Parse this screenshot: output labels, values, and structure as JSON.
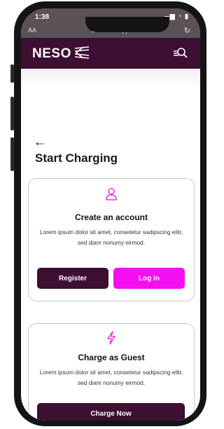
{
  "status_bar": {
    "time": "1:38",
    "icons": "▂▄▆ ◔ ▮"
  },
  "browser": {
    "text_size": "AA",
    "url": "nesoev.app",
    "reload": "↻"
  },
  "header": {
    "logo_text": "NESO",
    "search_icon": "search-icon"
  },
  "page": {
    "back": "←",
    "title": "Start Charging"
  },
  "account_card": {
    "title": "Create an account",
    "text": "Lorem ipsum dolor sit amet, consetetur sadipscing elitr, sed diam nonumy eirmod.",
    "register_label": "Register",
    "login_label": "Log in",
    "icon": "user-icon"
  },
  "guest_card": {
    "title": "Charge as Guest",
    "text": "Lorem ipsum dolor sit amet, consetetur sadipscing elitr, sed diam nonumy eirmod.",
    "charge_label": "Charge Now",
    "icon": "lightning-icon"
  },
  "colors": {
    "brand_dark": "#3d0f33",
    "brand_accent": "#f40ff0"
  }
}
